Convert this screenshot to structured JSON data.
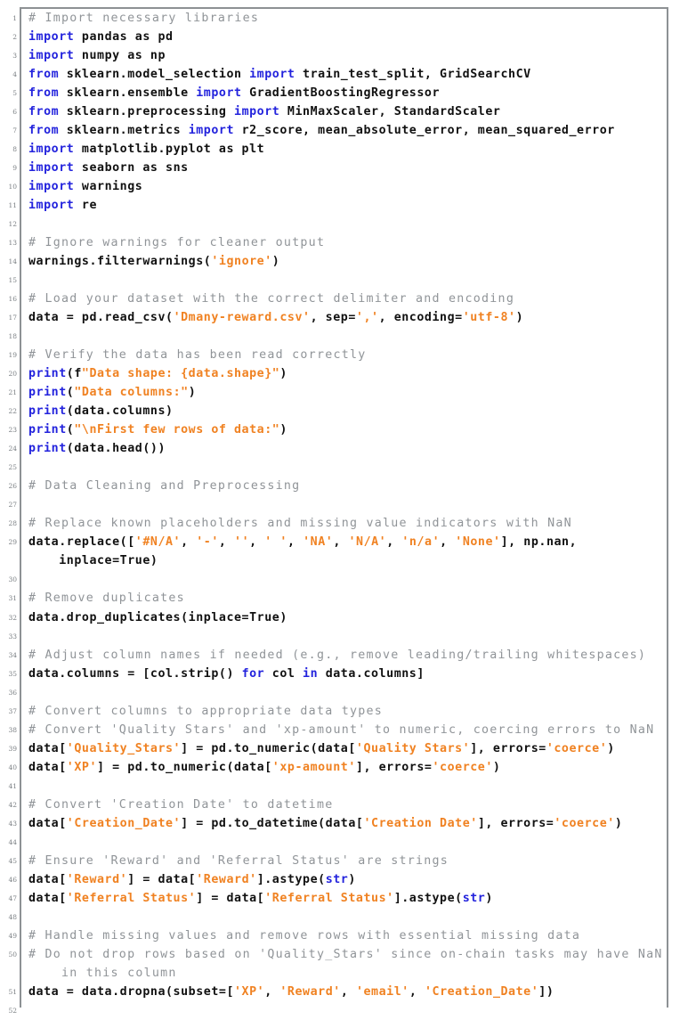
{
  "listing": {
    "language": "python",
    "colors": {
      "comment": "#909498",
      "keyword": "#2323dd",
      "string": "#f08222",
      "plain": "#111111",
      "lineno": "#7a7f83",
      "frame_border": "#8d9194",
      "background": "#ffffff"
    },
    "first_line": 1,
    "last_line": 52,
    "lines": [
      {
        "n": "1",
        "tokens": [
          {
            "t": "cmt",
            "v": "# Import necessary libraries"
          }
        ]
      },
      {
        "n": "2",
        "tokens": [
          {
            "t": "kw",
            "v": "import"
          },
          {
            "t": "pl",
            "v": " pandas as pd"
          }
        ]
      },
      {
        "n": "3",
        "tokens": [
          {
            "t": "kw",
            "v": "import"
          },
          {
            "t": "pl",
            "v": " numpy as np"
          }
        ]
      },
      {
        "n": "4",
        "tokens": [
          {
            "t": "kw",
            "v": "from"
          },
          {
            "t": "pl",
            "v": " sklearn.model_selection "
          },
          {
            "t": "kw",
            "v": "import"
          },
          {
            "t": "pl",
            "v": " train_test_split, GridSearchCV"
          }
        ]
      },
      {
        "n": "5",
        "tokens": [
          {
            "t": "kw",
            "v": "from"
          },
          {
            "t": "pl",
            "v": " sklearn.ensemble "
          },
          {
            "t": "kw",
            "v": "import"
          },
          {
            "t": "pl",
            "v": " GradientBoostingRegressor"
          }
        ]
      },
      {
        "n": "6",
        "tokens": [
          {
            "t": "kw",
            "v": "from"
          },
          {
            "t": "pl",
            "v": " sklearn.preprocessing "
          },
          {
            "t": "kw",
            "v": "import"
          },
          {
            "t": "pl",
            "v": " MinMaxScaler, StandardScaler"
          }
        ]
      },
      {
        "n": "7",
        "tokens": [
          {
            "t": "kw",
            "v": "from"
          },
          {
            "t": "pl",
            "v": " sklearn.metrics "
          },
          {
            "t": "kw",
            "v": "import"
          },
          {
            "t": "pl",
            "v": " r2_score, mean_absolute_error, mean_squared_error"
          }
        ]
      },
      {
        "n": "8",
        "tokens": [
          {
            "t": "kw",
            "v": "import"
          },
          {
            "t": "pl",
            "v": " matplotlib.pyplot as plt"
          }
        ]
      },
      {
        "n": "9",
        "tokens": [
          {
            "t": "kw",
            "v": "import"
          },
          {
            "t": "pl",
            "v": " seaborn as sns"
          }
        ]
      },
      {
        "n": "10",
        "tokens": [
          {
            "t": "kw",
            "v": "import"
          },
          {
            "t": "pl",
            "v": " warnings"
          }
        ]
      },
      {
        "n": "11",
        "tokens": [
          {
            "t": "kw",
            "v": "import"
          },
          {
            "t": "pl",
            "v": " re"
          }
        ]
      },
      {
        "n": "12",
        "tokens": []
      },
      {
        "n": "13",
        "tokens": [
          {
            "t": "cmt",
            "v": "# Ignore warnings for cleaner output"
          }
        ]
      },
      {
        "n": "14",
        "tokens": [
          {
            "t": "pl",
            "v": "warnings.filterwarnings("
          },
          {
            "t": "str",
            "v": "'ignore'"
          },
          {
            "t": "pl",
            "v": ")"
          }
        ]
      },
      {
        "n": "15",
        "tokens": []
      },
      {
        "n": "16",
        "tokens": [
          {
            "t": "cmt",
            "v": "# Load your dataset with the correct delimiter and encoding"
          }
        ]
      },
      {
        "n": "17",
        "tokens": [
          {
            "t": "pl",
            "v": "data = pd.read_csv("
          },
          {
            "t": "str",
            "v": "'Dmany-reward.csv'"
          },
          {
            "t": "pl",
            "v": ", sep="
          },
          {
            "t": "str",
            "v": "','"
          },
          {
            "t": "pl",
            "v": ", encoding="
          },
          {
            "t": "str",
            "v": "'utf-8'"
          },
          {
            "t": "pl",
            "v": ")"
          }
        ]
      },
      {
        "n": "18",
        "tokens": []
      },
      {
        "n": "19",
        "tokens": [
          {
            "t": "cmt",
            "v": "# Verify the data has been read correctly"
          }
        ]
      },
      {
        "n": "20",
        "tokens": [
          {
            "t": "kw",
            "v": "print"
          },
          {
            "t": "pl",
            "v": "(f"
          },
          {
            "t": "str",
            "v": "\"Data shape: {data.shape}\""
          },
          {
            "t": "pl",
            "v": ")"
          }
        ]
      },
      {
        "n": "21",
        "tokens": [
          {
            "t": "kw",
            "v": "print"
          },
          {
            "t": "pl",
            "v": "("
          },
          {
            "t": "str",
            "v": "\"Data columns:\""
          },
          {
            "t": "pl",
            "v": ")"
          }
        ]
      },
      {
        "n": "22",
        "tokens": [
          {
            "t": "kw",
            "v": "print"
          },
          {
            "t": "pl",
            "v": "(data.columns)"
          }
        ]
      },
      {
        "n": "23",
        "tokens": [
          {
            "t": "kw",
            "v": "print"
          },
          {
            "t": "pl",
            "v": "("
          },
          {
            "t": "str",
            "v": "\"\\nFirst few rows of data:\""
          },
          {
            "t": "pl",
            "v": ")"
          }
        ]
      },
      {
        "n": "24",
        "tokens": [
          {
            "t": "kw",
            "v": "print"
          },
          {
            "t": "pl",
            "v": "(data.head())"
          }
        ]
      },
      {
        "n": "25",
        "tokens": []
      },
      {
        "n": "26",
        "tokens": [
          {
            "t": "cmt",
            "v": "# Data Cleaning and Preprocessing"
          }
        ]
      },
      {
        "n": "27",
        "tokens": []
      },
      {
        "n": "28",
        "tokens": [
          {
            "t": "cmt",
            "v": "# Replace known placeholders and missing value indicators with NaN"
          }
        ]
      },
      {
        "n": "29",
        "tokens": [
          {
            "t": "pl",
            "v": "data.replace(["
          },
          {
            "t": "str",
            "v": "'#N/A'"
          },
          {
            "t": "pl",
            "v": ", "
          },
          {
            "t": "str",
            "v": "'-'"
          },
          {
            "t": "pl",
            "v": ", "
          },
          {
            "t": "str",
            "v": "''"
          },
          {
            "t": "pl",
            "v": ", "
          },
          {
            "t": "str",
            "v": "' '"
          },
          {
            "t": "pl",
            "v": ", "
          },
          {
            "t": "str",
            "v": "'NA'"
          },
          {
            "t": "pl",
            "v": ", "
          },
          {
            "t": "str",
            "v": "'N/A'"
          },
          {
            "t": "pl",
            "v": ", "
          },
          {
            "t": "str",
            "v": "'n/a'"
          },
          {
            "t": "pl",
            "v": ", "
          },
          {
            "t": "str",
            "v": "'None'"
          },
          {
            "t": "pl",
            "v": "], np.nan,"
          }
        ]
      },
      {
        "n": "",
        "tokens": [
          {
            "t": "pl",
            "v": "    inplace=True)"
          }
        ]
      },
      {
        "n": "30",
        "tokens": []
      },
      {
        "n": "31",
        "tokens": [
          {
            "t": "cmt",
            "v": "# Remove duplicates"
          }
        ]
      },
      {
        "n": "32",
        "tokens": [
          {
            "t": "pl",
            "v": "data.drop_duplicates(inplace=True)"
          }
        ]
      },
      {
        "n": "33",
        "tokens": []
      },
      {
        "n": "34",
        "tokens": [
          {
            "t": "cmt",
            "v": "# Adjust column names if needed (e.g., remove leading/trailing whitespaces)"
          }
        ]
      },
      {
        "n": "35",
        "tokens": [
          {
            "t": "pl",
            "v": "data.columns = [col.strip() "
          },
          {
            "t": "kw",
            "v": "for"
          },
          {
            "t": "pl",
            "v": " col "
          },
          {
            "t": "kw",
            "v": "in"
          },
          {
            "t": "pl",
            "v": " data.columns]"
          }
        ]
      },
      {
        "n": "36",
        "tokens": []
      },
      {
        "n": "37",
        "tokens": [
          {
            "t": "cmt",
            "v": "# Convert columns to appropriate data types"
          }
        ]
      },
      {
        "n": "38",
        "tokens": [
          {
            "t": "cmt",
            "v": "# Convert 'Quality Stars' and 'xp-amount' to numeric, coercing errors to NaN"
          }
        ]
      },
      {
        "n": "39",
        "tokens": [
          {
            "t": "pl",
            "v": "data["
          },
          {
            "t": "str",
            "v": "'Quality_Stars'"
          },
          {
            "t": "pl",
            "v": "] = pd.to_numeric(data["
          },
          {
            "t": "str",
            "v": "'Quality Stars'"
          },
          {
            "t": "pl",
            "v": "], errors="
          },
          {
            "t": "str",
            "v": "'coerce'"
          },
          {
            "t": "pl",
            "v": ")"
          }
        ]
      },
      {
        "n": "40",
        "tokens": [
          {
            "t": "pl",
            "v": "data["
          },
          {
            "t": "str",
            "v": "'XP'"
          },
          {
            "t": "pl",
            "v": "] = pd.to_numeric(data["
          },
          {
            "t": "str",
            "v": "'xp-amount'"
          },
          {
            "t": "pl",
            "v": "], errors="
          },
          {
            "t": "str",
            "v": "'coerce'"
          },
          {
            "t": "pl",
            "v": ")"
          }
        ]
      },
      {
        "n": "41",
        "tokens": []
      },
      {
        "n": "42",
        "tokens": [
          {
            "t": "cmt",
            "v": "# Convert 'Creation Date' to datetime"
          }
        ]
      },
      {
        "n": "43",
        "tokens": [
          {
            "t": "pl",
            "v": "data["
          },
          {
            "t": "str",
            "v": "'Creation_Date'"
          },
          {
            "t": "pl",
            "v": "] = pd.to_datetime(data["
          },
          {
            "t": "str",
            "v": "'Creation Date'"
          },
          {
            "t": "pl",
            "v": "], errors="
          },
          {
            "t": "str",
            "v": "'coerce'"
          },
          {
            "t": "pl",
            "v": ")"
          }
        ]
      },
      {
        "n": "44",
        "tokens": []
      },
      {
        "n": "45",
        "tokens": [
          {
            "t": "cmt",
            "v": "# Ensure 'Reward' and 'Referral Status' are strings"
          }
        ]
      },
      {
        "n": "46",
        "tokens": [
          {
            "t": "pl",
            "v": "data["
          },
          {
            "t": "str",
            "v": "'Reward'"
          },
          {
            "t": "pl",
            "v": "] = data["
          },
          {
            "t": "str",
            "v": "'Reward'"
          },
          {
            "t": "pl",
            "v": "].astype("
          },
          {
            "t": "kw",
            "v": "str"
          },
          {
            "t": "pl",
            "v": ")"
          }
        ]
      },
      {
        "n": "47",
        "tokens": [
          {
            "t": "pl",
            "v": "data["
          },
          {
            "t": "str",
            "v": "'Referral Status'"
          },
          {
            "t": "pl",
            "v": "] = data["
          },
          {
            "t": "str",
            "v": "'Referral Status'"
          },
          {
            "t": "pl",
            "v": "].astype("
          },
          {
            "t": "kw",
            "v": "str"
          },
          {
            "t": "pl",
            "v": ")"
          }
        ]
      },
      {
        "n": "48",
        "tokens": []
      },
      {
        "n": "49",
        "tokens": [
          {
            "t": "cmt",
            "v": "# Handle missing values and remove rows with essential missing data"
          }
        ]
      },
      {
        "n": "50",
        "tokens": [
          {
            "t": "cmt",
            "v": "# Do not drop rows based on 'Quality_Stars' since on-chain tasks may have NaN"
          }
        ]
      },
      {
        "n": "",
        "tokens": [
          {
            "t": "cmt",
            "v": "    in this column"
          }
        ]
      },
      {
        "n": "51",
        "tokens": [
          {
            "t": "pl",
            "v": "data = data.dropna(subset=["
          },
          {
            "t": "str",
            "v": "'XP'"
          },
          {
            "t": "pl",
            "v": ", "
          },
          {
            "t": "str",
            "v": "'Reward'"
          },
          {
            "t": "pl",
            "v": ", "
          },
          {
            "t": "str",
            "v": "'email'"
          },
          {
            "t": "pl",
            "v": ", "
          },
          {
            "t": "str",
            "v": "'Creation_Date'"
          },
          {
            "t": "pl",
            "v": "])"
          }
        ]
      },
      {
        "n": "52",
        "tokens": []
      }
    ]
  }
}
